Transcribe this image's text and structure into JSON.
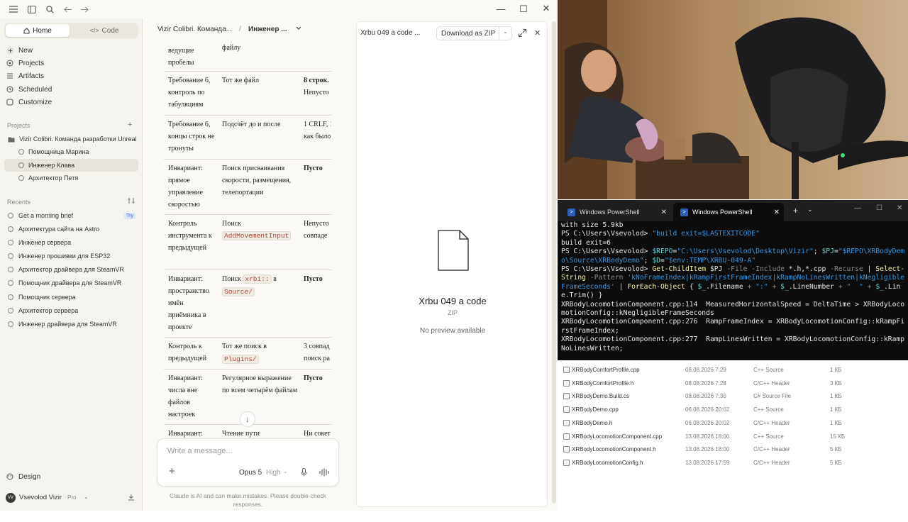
{
  "claude": {
    "sidebar": {
      "home_tab": "Home",
      "code_tab": "Code",
      "nav": [
        "New",
        "Projects",
        "Artifacts",
        "Scheduled",
        "Customize"
      ],
      "projects_label": "Projects",
      "project_name": "Vizir Colibri. Команда разработки Unreal",
      "project_items": [
        "Помощница Марина",
        "Инженер Клава",
        "Архитектор Петя"
      ],
      "recents_label": "Recents",
      "recents": [
        "Get a morning brief",
        "Архитектура сайта на Astro",
        "Инженер сервера",
        "Инженер прошивки для ESP32",
        "Архитектор драйвера для SteamVR",
        "Помощник драйвера для SteamVR",
        "Помощник сервера",
        "Архитектор сервера",
        "Инженер драйвера для SteamVR"
      ],
      "try_badge": "Try",
      "design": "Design",
      "user_initials": "VV",
      "user_name": "Vsevolod Vizir",
      "user_plan": "Pro"
    },
    "chat": {
      "breadcrumb_project": "Vizir Colibri. Команда...",
      "breadcrumb_sep": "/",
      "breadcrumb_chat": "Инженер ...",
      "rows": [
        {
          "c1": "ведущие пробелы",
          "c2": "файлу",
          "c3": ""
        },
        {
          "c1": "Требование 6, контроль по табуляциям",
          "c2": "Тот же файл",
          "c3a": "8 строк.",
          "c3b": "Непусто"
        },
        {
          "c1": "Требование 6, концы строк не тронуты",
          "c2": "Подсчёт до и после",
          "c3a": "1 CRLF, 1",
          "c3b": "как было"
        },
        {
          "c1": "Инвариант: прямое управление скоростью",
          "c2": "Поиск присваивания скорости, размещения, телепортации",
          "c3a": "Пусто"
        },
        {
          "c1": "Контроль инструмента к предыдущей",
          "c2a": "Поиск",
          "c2code": "AddMovementInput",
          "c3a": "Непусто",
          "c3b": "совпаде"
        },
        {
          "c1": "Инвариант: пространство имён приёмника в проекте",
          "c2a": "Поиск",
          "c2code": "xrbi::",
          "c2b": "в",
          "c2code2": "Source/",
          "c3a": "Пусто"
        },
        {
          "c1": "Контроль к предыдущей",
          "c2a": "Тот же поиск в",
          "c2code": "Plugins/",
          "c3a": "3 совпад",
          "c3b": "поиск ра"
        },
        {
          "c1": "Инвариант: числа вне файлов настроек",
          "c2": "Регулярное выражение по всем четырём файлам",
          "c3a": "Пусто"
        },
        {
          "c1": "Инвариант:",
          "c2": "Чтение пути",
          "c3a": "Ни сокет"
        }
      ],
      "composer_placeholder": "Write a message...",
      "model": "Opus 5",
      "effort": "High",
      "disclaimer": "Claude is AI and can make mistakes. Please double-check responses."
    },
    "artifact": {
      "title": "Xrbu 049 a code  ...",
      "download": "Download as ZIP",
      "file_name": "Xrbu 049 a code",
      "file_type": "ZIP",
      "no_preview": "No preview available"
    }
  },
  "powershell": {
    "tab1": "Windows PowerShell",
    "tab2": "Windows PowerShell",
    "lines": {
      "l1": "with size 5.9kb",
      "p": "PS C:\\Users\\Vsevolod> ",
      "l2": "\"build exit=$LASTEXITCODE\"",
      "l3": "build exit=6",
      "l4a": "$REPO",
      "l4b": "=",
      "l4c": "\"C:\\Users\\Vsevolod\\Desktop\\Vizir\"",
      "l4d": "; ",
      "l4e": "$PJ",
      "l4f": "=",
      "l4g": "\"$REPO\\XRBody",
      "l4h": "Demo\\Source\\XRBodyDemo\"",
      "l4i": "; ",
      "l4j": "$D",
      "l4k": "=",
      "l4l": "\"$env:TEMP\\XRBU-049-A\"",
      "l5a": "Get-ChildItem",
      "l5b": " $PJ ",
      "l5c": "-File -Include",
      "l5d": " *.h,*.cpp ",
      "l5e": "-Recurse",
      "l5f": " | ",
      "l5g": "Select-String",
      "l5h": " -Pattern ",
      "l5i": "'kNoFrameIndex|kRampFirstFrameIndex|kRampNoLinesWritten|kNegligibleFrameSeconds'",
      "l5j": " | ",
      "l5k": "ForEach-Object",
      "l5l": " { ",
      "l5m": "$_",
      "l5n": ".Filename ",
      "l5o": "+",
      "l5p": " \":\" ",
      "l5q": "+",
      "l5r": " $_",
      "l5s": ".LineNumber ",
      "l5t": "+",
      "l5u": " \"  \" ",
      "l5v": "+",
      "l5w": " $_",
      "l5x": ".Line.Trim() }",
      "o1": "XRBodyLocomotionComponent.cpp:114  MeasuredHorizontalSpeed = DeltaTime > XRBodyLocomotionConfig::kNegligibleFrameSeconds",
      "o2": "XRBodyLocomotionComponent.cpp:276  RampFrameIndex = XRBodyLocomotionConfig::kRampFirstFrameIndex;",
      "o3": "XRBodyLocomotionComponent.cpp:277  RampLinesWritten = XRBodyLocomotionConfig::kRampNoLinesWritten;"
    }
  },
  "explorer": {
    "files": [
      {
        "name": "XRBodyComfortProfile.cpp",
        "date": "08.08.2026 7:29",
        "type": "C++ Source",
        "size": "1 КБ"
      },
      {
        "name": "XRBodyComfortProfile.h",
        "date": "08.08.2026 7:28",
        "type": "C/C++ Header",
        "size": "3 КБ"
      },
      {
        "name": "XRBodyDemo.Build.cs",
        "date": "08.08.2026 7:30",
        "type": "C# Source File",
        "size": "1 КБ"
      },
      {
        "name": "XRBodyDemo.cpp",
        "date": "06.08.2026 20:02",
        "type": "C++ Source",
        "size": "1 КБ"
      },
      {
        "name": "XRBodyDemo.h",
        "date": "06.08.2026 20:02",
        "type": "C/C++ Header",
        "size": "1 КБ"
      },
      {
        "name": "XRBodyLocomotionComponent.cpp",
        "date": "13.08.2026 18:00",
        "type": "C++ Source",
        "size": "15 КБ"
      },
      {
        "name": "XRBodyLocomotionComponent.h",
        "date": "13.08.2026 18:00",
        "type": "C/C++ Header",
        "size": "5 КБ"
      },
      {
        "name": "XRBodyLocomotionConfig.h",
        "date": "13.08.2026 17:59",
        "type": "C/C++ Header",
        "size": "5 КБ"
      }
    ]
  }
}
